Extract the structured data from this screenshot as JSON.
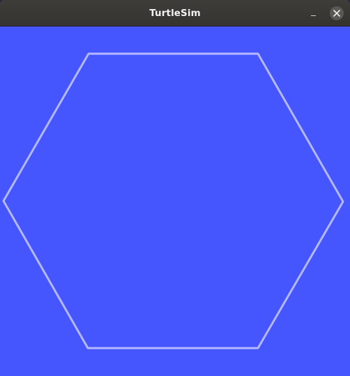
{
  "window": {
    "title": "TurtleSim",
    "background_color": "#4556ff",
    "pen_color": "#b3b8ff"
  },
  "controls": {
    "minimize_icon": "minimize-icon",
    "close_icon": "close-icon"
  },
  "drawing": {
    "shape": "hexagon"
  }
}
